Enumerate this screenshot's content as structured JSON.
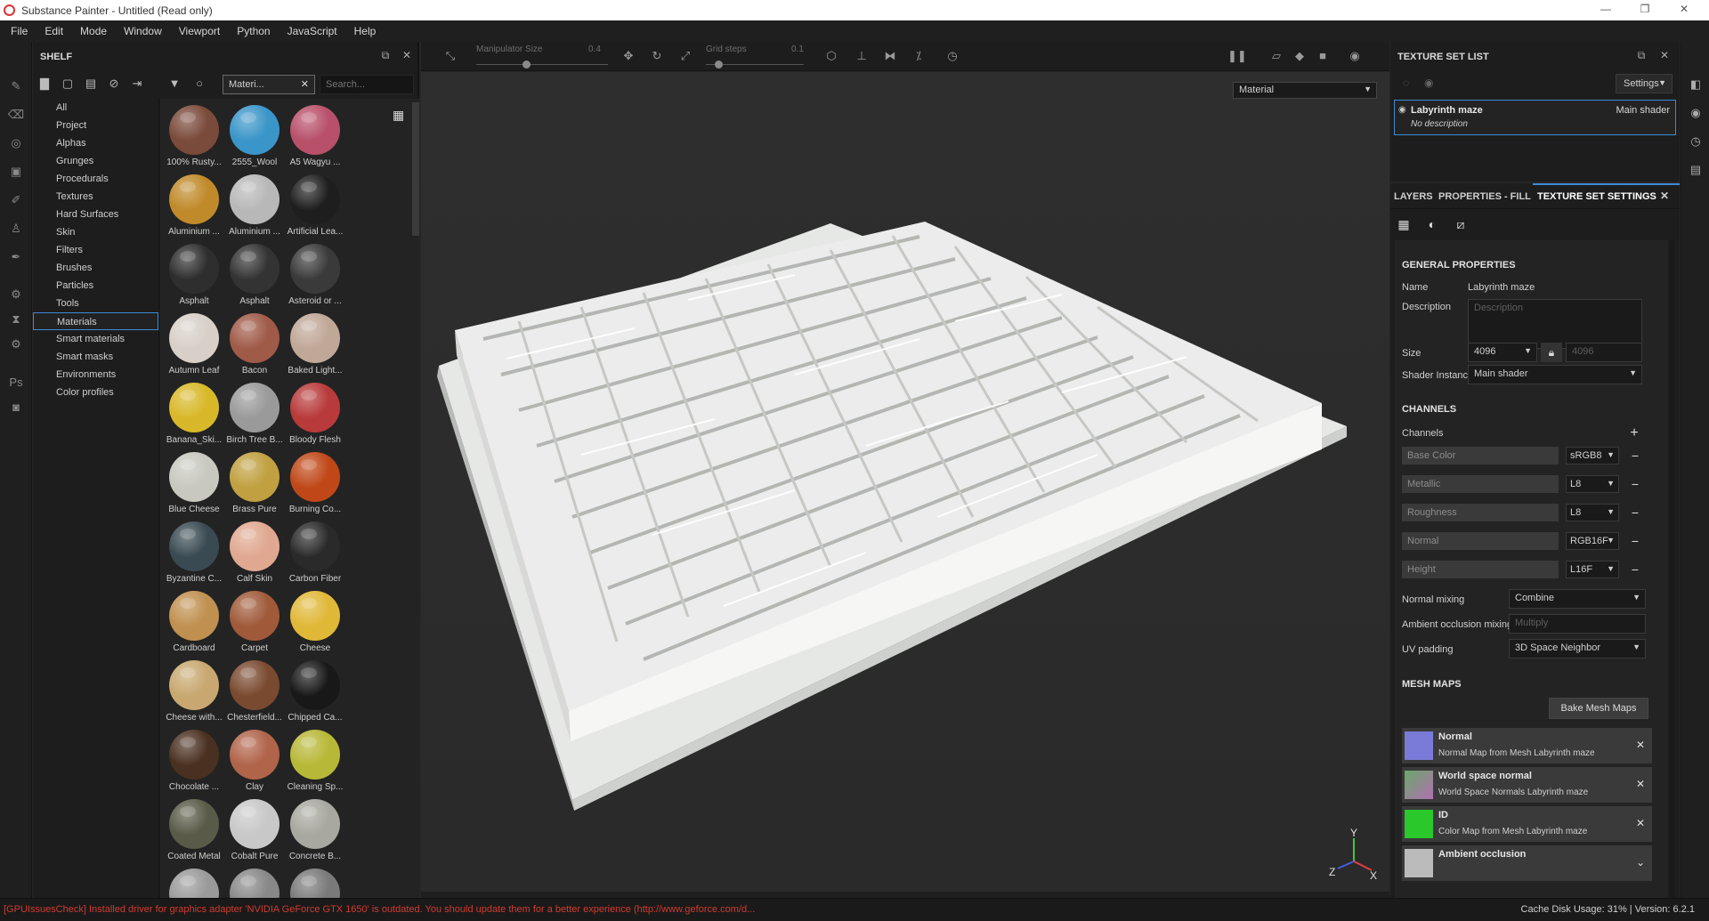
{
  "window": {
    "title": "Substance Painter - Untitled (Read only)",
    "controls": [
      "—",
      "❐",
      "✕"
    ]
  },
  "menu": [
    "File",
    "Edit",
    "Mode",
    "Window",
    "Viewport",
    "Python",
    "JavaScript",
    "Help"
  ],
  "shelf": {
    "title": "SHELF",
    "filter_chip": "Materi...",
    "search_placeholder": "Search...",
    "categories": [
      "All",
      "Project",
      "Alphas",
      "Grunges",
      "Procedurals",
      "Textures",
      "Hard Surfaces",
      "Skin",
      "Filters",
      "Brushes",
      "Particles",
      "Tools",
      "Materials",
      "Smart materials",
      "Smart masks",
      "Environments",
      "Color profiles"
    ],
    "active_category": "Materials",
    "materials": [
      {
        "label": "100% Rusty...",
        "color": "#7a4a3a"
      },
      {
        "label": "2555_Wool",
        "color": "#3a95c8"
      },
      {
        "label": "A5 Wagyu ...",
        "color": "#b8506a"
      },
      {
        "label": "Aluminium ...",
        "color": "#c08a2a"
      },
      {
        "label": "Aluminium ...",
        "color": "#b8b8b8"
      },
      {
        "label": "Artificial Lea...",
        "color": "#1e1e1e"
      },
      {
        "label": "Asphalt",
        "color": "#2e2e2e"
      },
      {
        "label": "Asphalt",
        "color": "#333333"
      },
      {
        "label": "Asteroid or ...",
        "color": "#3a3a3a"
      },
      {
        "label": "Autumn Leaf",
        "color": "#d8d0c8"
      },
      {
        "label": "Bacon",
        "color": "#a05a48"
      },
      {
        "label": "Baked Light...",
        "color": "#c0a898"
      },
      {
        "label": "Banana_Ski...",
        "color": "#d8b828"
      },
      {
        "label": "Birch Tree B...",
        "color": "#9a9a9a"
      },
      {
        "label": "Bloody Flesh",
        "color": "#b83a3a"
      },
      {
        "label": "Blue Cheese",
        "color": "#c8c8c0"
      },
      {
        "label": "Brass Pure",
        "color": "#c0a040"
      },
      {
        "label": "Burning Co...",
        "color": "#c04818"
      },
      {
        "label": "Byzantine C...",
        "color": "#3a4a52"
      },
      {
        "label": "Calf Skin",
        "color": "#e0a890"
      },
      {
        "label": "Carbon Fiber",
        "color": "#2a2a2a"
      },
      {
        "label": "Cardboard",
        "color": "#c09050"
      },
      {
        "label": "Carpet",
        "color": "#a05a3a"
      },
      {
        "label": "Cheese",
        "color": "#e0b838"
      },
      {
        "label": "Cheese with...",
        "color": "#c8a870"
      },
      {
        "label": "Chesterfield...",
        "color": "#7a4a30"
      },
      {
        "label": "Chipped Ca...",
        "color": "#181818"
      },
      {
        "label": "Chocolate ...",
        "color": "#4a3020"
      },
      {
        "label": "Clay",
        "color": "#b0644a"
      },
      {
        "label": "Cleaning Sp...",
        "color": "#b8b838"
      },
      {
        "label": "Coated Metal",
        "color": "#5a5a48"
      },
      {
        "label": "Cobalt Pure",
        "color": "#c8c8c8"
      },
      {
        "label": "Concrete B...",
        "color": "#a8a8a0"
      },
      {
        "label": "",
        "color": "#9a9a9a"
      },
      {
        "label": "",
        "color": "#888888"
      },
      {
        "label": "",
        "color": "#7a7a7a"
      }
    ]
  },
  "viewport_toolbar": {
    "manipulator_label": "Manipulator Size",
    "manipulator_value": "0.4",
    "grid_label": "Grid steps",
    "grid_value": "0.1"
  },
  "viewport": {
    "mode": "Material",
    "gizmo_axes": [
      "Y",
      "Z",
      "X"
    ]
  },
  "texture_set_list": {
    "title": "TEXTURE SET LIST",
    "settings_label": "Settings",
    "item_name": "Labyrinth maze",
    "item_shader": "Main shader",
    "item_desc": "No description"
  },
  "props": {
    "tabs": [
      "LAYERS",
      "PROPERTIES - FILL",
      "TEXTURE SET SETTINGS"
    ],
    "active_tab": "TEXTURE SET SETTINGS",
    "general": {
      "title": "GENERAL PROPERTIES",
      "name_label": "Name",
      "name_value": "Labyrinth maze",
      "desc_label": "Description",
      "desc_placeholder": "Description",
      "size_label": "Size",
      "size_value": "4096",
      "size_linked": "4096",
      "shader_label": "Shader Instance",
      "shader_value": "Main shader"
    },
    "channels": {
      "title": "CHANNELS",
      "label": "Channels",
      "list": [
        {
          "name": "Base Color",
          "format": "sRGB8"
        },
        {
          "name": "Metallic",
          "format": "L8"
        },
        {
          "name": "Roughness",
          "format": "L8"
        },
        {
          "name": "Normal",
          "format": "RGB16F"
        },
        {
          "name": "Height",
          "format": "L16F"
        }
      ],
      "normal_mixing_label": "Normal mixing",
      "normal_mixing_value": "Combine",
      "ao_mixing_label": "Ambient occlusion mixing",
      "ao_mixing_value": "Multiply",
      "uv_padding_label": "UV padding",
      "uv_padding_value": "3D Space Neighbor"
    },
    "mesh_maps": {
      "title": "MESH MAPS",
      "bake_label": "Bake Mesh Maps",
      "maps": [
        {
          "title": "Normal",
          "sub": "Normal Map from Mesh Labyrinth maze",
          "color": "#7a7ad8"
        },
        {
          "title": "World space normal",
          "sub": "World Space Normals Labyrinth maze",
          "color": "#6aa86a"
        },
        {
          "title": "ID",
          "sub": "Color Map from Mesh Labyrinth maze",
          "color": "#2ac82a"
        },
        {
          "title": "Ambient occlusion",
          "sub": "",
          "color": "#bbbbbb"
        }
      ]
    }
  },
  "status": {
    "message": "[GPUIssuesCheck] Installed driver for graphics adapter 'NVIDIA GeForce GTX 1650' is outdated. You should update them for a better experience (http://www.geforce.com/d...",
    "info": "Cache Disk Usage:   31% | Version: 6.2.1"
  }
}
